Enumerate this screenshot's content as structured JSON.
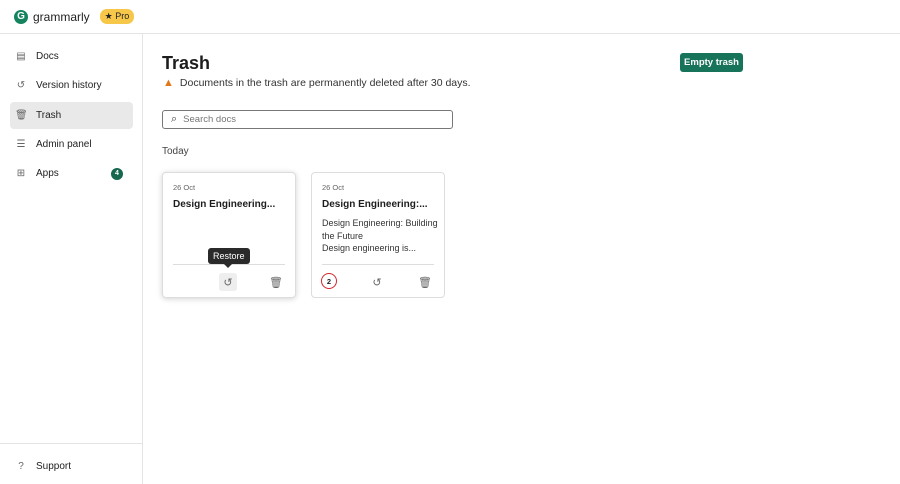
{
  "header": {
    "brand": "grammarly",
    "logo_letter": "G",
    "plan_badge": "★ Pro"
  },
  "sidebar": {
    "items": [
      {
        "label": "Docs",
        "icon": "doc-icon"
      },
      {
        "label": "Version history",
        "icon": "history-icon"
      },
      {
        "label": "Trash",
        "icon": "trash-icon",
        "active": true
      },
      {
        "label": "Admin panel",
        "icon": "sliders-icon"
      },
      {
        "label": "Apps",
        "icon": "apps-icon",
        "badge": "4"
      }
    ],
    "support": "Support"
  },
  "main": {
    "title": "Trash",
    "empty_button": "Empty trash",
    "warning": "Documents in the trash are permanently deleted after 30 days.",
    "search_placeholder": "Search docs",
    "group": "Today",
    "cards": [
      {
        "date": "26 Oct",
        "title": "Design Engineering...",
        "snippet": ""
      },
      {
        "date": "26 Oct",
        "title": "Design Engineering:...",
        "snippet_lines": [
          "Design Engineering: Building",
          "the Future",
          "Design engineering is..."
        ],
        "count": "2"
      }
    ],
    "tooltip": "Restore"
  },
  "colors": {
    "accent": "#17735a",
    "pro": "#f7c74a",
    "warning": "#e0781a",
    "count_ring": "#d2262a"
  }
}
